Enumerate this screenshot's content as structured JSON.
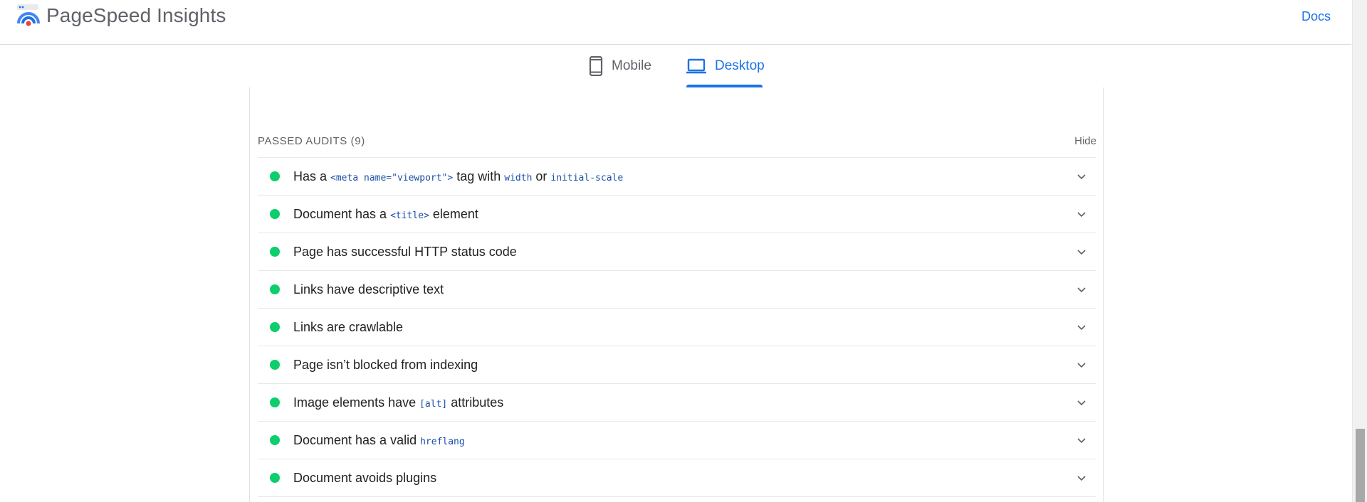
{
  "header": {
    "title": "PageSpeed Insights",
    "docs_label": "Docs",
    "logo_icon": "pagespeed-logo-icon"
  },
  "tabs": [
    {
      "label": "Mobile",
      "icon": "phone-icon",
      "active": false
    },
    {
      "label": "Desktop",
      "icon": "laptop-icon",
      "active": true
    }
  ],
  "colors": {
    "accent": "#1a73e8",
    "pass": "#0cce6b",
    "code": "#1a4ea5"
  },
  "passed": {
    "title": "PASSED AUDITS",
    "count": "(9)",
    "hide_label": "Hide",
    "audits": [
      {
        "parts": [
          "Has a ",
          "<meta name=\"viewport\">",
          " tag with ",
          "width",
          " or ",
          "initial-scale"
        ]
      },
      {
        "parts": [
          "Document has a ",
          "<title>",
          " element"
        ]
      },
      {
        "parts": [
          "Page has successful HTTP status code"
        ]
      },
      {
        "parts": [
          "Links have descriptive text"
        ]
      },
      {
        "parts": [
          "Links are crawlable"
        ]
      },
      {
        "parts": [
          "Page isn’t blocked from indexing"
        ]
      },
      {
        "parts": [
          "Image elements have ",
          "[alt]",
          " attributes"
        ]
      },
      {
        "parts": [
          "Document has a valid ",
          "hreflang"
        ]
      },
      {
        "parts": [
          "Document avoids plugins"
        ]
      }
    ]
  }
}
